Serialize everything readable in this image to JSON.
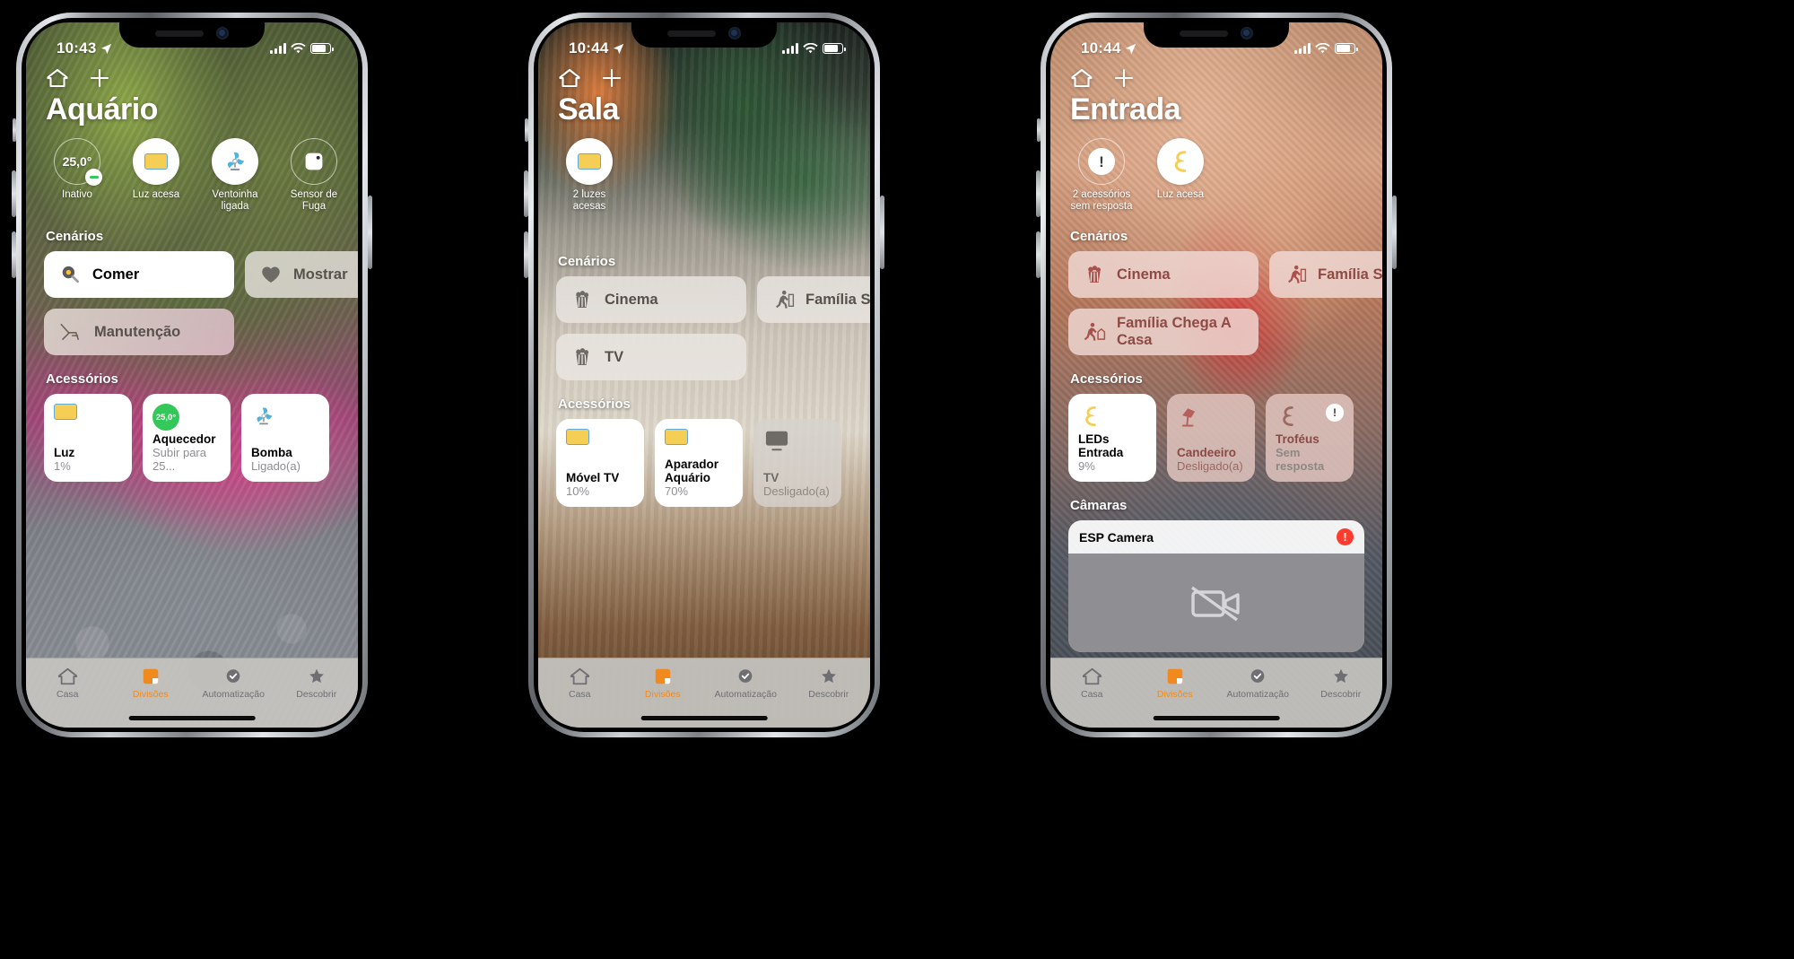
{
  "app": {
    "name": "Home"
  },
  "phones": [
    {
      "id": "phone-aquario",
      "status": {
        "time": "10:43",
        "location_icon": "location-arrow-icon",
        "signal": "cellular-bars-icon",
        "wifi": "wifi-icon",
        "battery": "battery-icon"
      },
      "nav": {
        "home_icon": "home-icon",
        "add_icon": "plus-icon"
      },
      "title": "Aquário",
      "status_circles": [
        {
          "name": "thermostat",
          "icon": "temperature-value",
          "value": "25,0°",
          "label": "Inativo",
          "style": "ghost",
          "badge": "minus-badge"
        },
        {
          "name": "light",
          "icon": "light-rectangle-icon",
          "label": "Luz acesa",
          "style": "solid"
        },
        {
          "name": "fan",
          "icon": "fan-icon",
          "label": "Ventoinha ligada",
          "style": "solid"
        },
        {
          "name": "leak-sensor",
          "icon": "sensor-square-icon",
          "label": "Sensor de Fuga",
          "style": "ghost"
        }
      ],
      "sections": {
        "scenes": "Cenários",
        "accessories": "Acessórios"
      },
      "scenes": [
        {
          "label": "Comer",
          "icon": "frying-pan-icon",
          "state": "on"
        },
        {
          "label": "Mostrar",
          "icon": "heart-icon",
          "state": "off"
        },
        {
          "label": "Manutenção",
          "icon": "deck-chair-icon",
          "state": "off"
        }
      ],
      "accessories": [
        {
          "name": "Luz",
          "sub": "1%",
          "icon": "light-rectangle-icon",
          "state": "on"
        },
        {
          "name": "Aquecedor",
          "sub": "Subir para 25...",
          "icon": "heater-temp-icon",
          "badge_value": "25,0°",
          "state": "on"
        },
        {
          "name": "Bomba",
          "sub": "Ligado(a)",
          "icon": "fan-icon",
          "state": "on"
        }
      ],
      "tabs": [
        {
          "label": "Casa",
          "icon": "home-icon",
          "active": false
        },
        {
          "label": "Divisões",
          "icon": "rooms-icon",
          "active": true
        },
        {
          "label": "Automatização",
          "icon": "automation-clock-icon",
          "active": false
        },
        {
          "label": "Descobrir",
          "icon": "star-icon",
          "active": false
        }
      ]
    },
    {
      "id": "phone-sala",
      "status": {
        "time": "10:44",
        "location_icon": "location-arrow-icon",
        "signal": "cellular-bars-icon",
        "wifi": "wifi-icon",
        "battery": "battery-icon"
      },
      "nav": {
        "home_icon": "home-icon",
        "add_icon": "plus-icon"
      },
      "title": "Sala",
      "status_circles": [
        {
          "name": "lights",
          "icon": "light-rectangle-icon",
          "label": "2 luzes acesas",
          "style": "solid"
        }
      ],
      "sections": {
        "scenes": "Cenários",
        "accessories": "Acessórios"
      },
      "scenes": [
        {
          "label": "Cinema",
          "icon": "popcorn-icon",
          "state": "off"
        },
        {
          "label": "Família S...",
          "icon": "person-walking-icon",
          "state": "off"
        },
        {
          "label": "TV",
          "icon": "popcorn-icon",
          "state": "off"
        }
      ],
      "accessories": [
        {
          "name": "Móvel TV",
          "sub": "10%",
          "icon": "light-rectangle-icon",
          "state": "on"
        },
        {
          "name": "Aparador Aquário",
          "sub": "70%",
          "icon": "light-rectangle-icon",
          "state": "on"
        },
        {
          "name": "TV",
          "sub": "Desligado(a)",
          "icon": "tv-icon",
          "state": "off"
        }
      ],
      "tabs": [
        {
          "label": "Casa",
          "icon": "home-icon",
          "active": false
        },
        {
          "label": "Divisões",
          "icon": "rooms-icon",
          "active": true
        },
        {
          "label": "Automatização",
          "icon": "automation-clock-icon",
          "active": false
        },
        {
          "label": "Descobrir",
          "icon": "star-icon",
          "active": false
        }
      ]
    },
    {
      "id": "phone-entrada",
      "status": {
        "time": "10:44",
        "location_icon": "location-arrow-icon",
        "signal": "cellular-bars-icon",
        "wifi": "wifi-icon",
        "battery": "battery-icon"
      },
      "nav": {
        "home_icon": "home-icon",
        "add_icon": "plus-icon"
      },
      "title": "Entrada",
      "status_circles": [
        {
          "name": "unresponsive",
          "icon": "exclamation-icon",
          "label": "2 acessórios sem resposta",
          "style": "ghost"
        },
        {
          "name": "light",
          "icon": "led-strip-icon",
          "label": "Luz acesa",
          "style": "solid"
        }
      ],
      "sections": {
        "scenes": "Cenários",
        "accessories": "Acessórios",
        "cameras": "Câmaras"
      },
      "scenes": [
        {
          "label": "Cinema",
          "icon": "popcorn-icon",
          "state": "off"
        },
        {
          "label": "Família S...",
          "icon": "person-walking-icon",
          "state": "off"
        },
        {
          "label": "Família Chega A Casa",
          "icon": "person-walking-icon",
          "state": "off"
        }
      ],
      "accessories": [
        {
          "name": "LEDs Entrada",
          "sub": "9%",
          "icon": "led-strip-icon",
          "state": "on"
        },
        {
          "name": "Candeeiro",
          "sub": "Desligado(a)",
          "icon": "lamp-icon",
          "state": "off"
        },
        {
          "name": "Troféus",
          "sub": "Sem resposta",
          "icon": "led-strip-icon",
          "state": "off",
          "alert": true,
          "badge": "exclamation-icon"
        }
      ],
      "cameras": [
        {
          "name": "ESP Camera",
          "status_icon": "error-badge-icon",
          "status_symbol": "!",
          "stream_icon": "camera-off-icon"
        }
      ],
      "tabs": [
        {
          "label": "Casa",
          "icon": "home-icon",
          "active": false
        },
        {
          "label": "Divisões",
          "icon": "rooms-icon",
          "active": true
        },
        {
          "label": "Automatização",
          "icon": "automation-clock-icon",
          "active": false
        },
        {
          "label": "Descobrir",
          "icon": "star-icon",
          "active": false
        }
      ]
    }
  ],
  "colors": {
    "accent": "#f08a1e",
    "alert": "#ff3b30",
    "green": "#34c759",
    "light_yellow": "#f5cf55",
    "fan_blue": "#4fb3e0"
  }
}
